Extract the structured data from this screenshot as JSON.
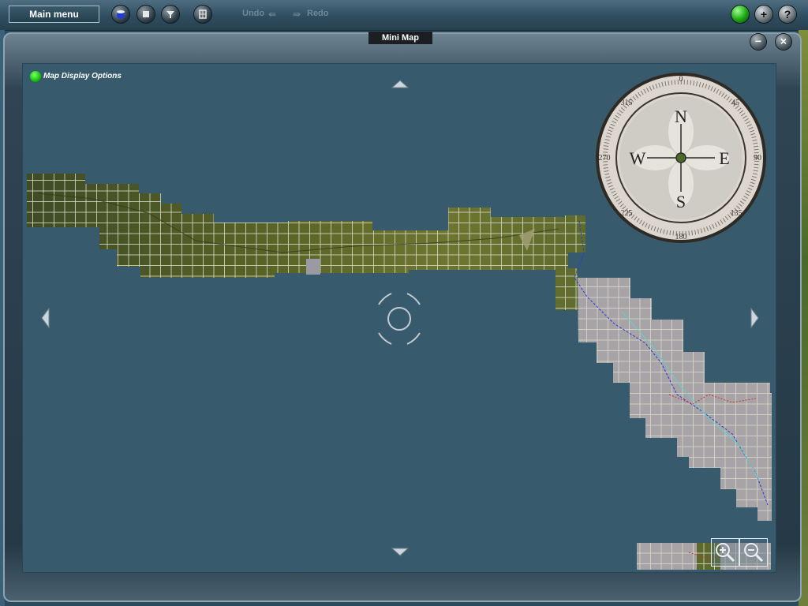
{
  "toolbar": {
    "main_menu": "Main menu",
    "undo": "Undo",
    "redo": "Redo",
    "icons": [
      "globe-icon",
      "stop-icon",
      "filter-icon",
      "grid-icon"
    ],
    "right_icons": [
      "status-led-icon",
      "plus-icon",
      "help-icon"
    ],
    "plus_glyph": "+",
    "help_glyph": "?"
  },
  "panel": {
    "title": "Mini Map",
    "minimize_glyph": "−",
    "close_glyph": "×"
  },
  "map": {
    "display_options_label": "Map Display Options",
    "compass": {
      "directions": {
        "north": "N",
        "south": "S",
        "east": "E",
        "west": "W"
      },
      "degree_labels": [
        "0",
        "45",
        "90",
        "135",
        "180",
        "225",
        "270",
        "315"
      ]
    },
    "zoom_controls": [
      "zoom-in-icon",
      "zoom-out-icon"
    ],
    "colors": {
      "water": "#385a6d",
      "terrain_dark": "#4c5a25",
      "terrain_light": "#6f7a35",
      "tile_gray": "#a6a2a6",
      "tile_border": "#e6e6e6",
      "track_blue": "#2d38d6",
      "track_red": "#d23030",
      "highlight_cyan": "#65d1c9"
    }
  }
}
